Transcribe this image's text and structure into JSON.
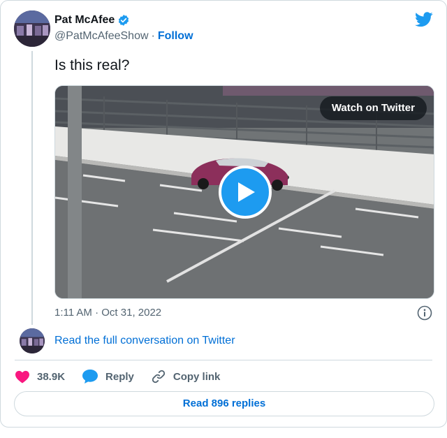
{
  "author": {
    "name": "Pat McAfee",
    "handle": "@PatMcAfeeShow",
    "separator": "·",
    "follow_label": "Follow"
  },
  "tweet": {
    "text": "Is this real?",
    "timestamp": "1:11 AM · Oct 31, 2022"
  },
  "media": {
    "watch_label": "Watch on Twitter"
  },
  "conversation": {
    "link_label": "Read the full conversation on Twitter"
  },
  "actions": {
    "likes": "38.9K",
    "reply_label": "Reply",
    "copy_label": "Copy link"
  },
  "footer": {
    "replies_label": "Read 896 replies"
  },
  "colors": {
    "accent": "#1d9bf0",
    "link": "#006fd6",
    "like": "#f91880",
    "muted": "#536471"
  },
  "icons": {
    "verified": "verified-badge-icon",
    "logo": "twitter-bird-icon",
    "play": "play-icon",
    "info": "info-icon",
    "like": "heart-icon",
    "reply": "speech-bubble-icon",
    "copy": "link-icon"
  }
}
